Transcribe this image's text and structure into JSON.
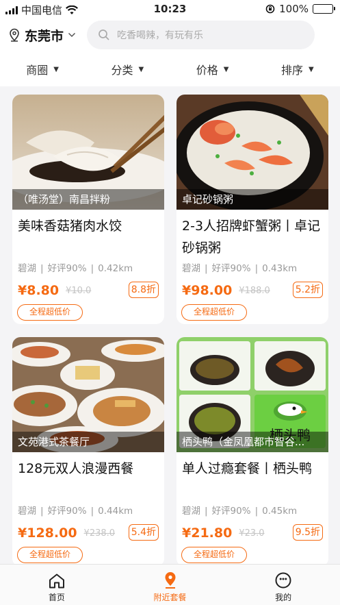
{
  "status_bar": {
    "carrier": "中国电信",
    "time": "10:23",
    "battery": "100%"
  },
  "header": {
    "city": "东莞市",
    "search_placeholder": "吃香喝辣，有玩有乐"
  },
  "filters": [
    {
      "label": "商圈"
    },
    {
      "label": "分类"
    },
    {
      "label": "价格"
    },
    {
      "label": "排序"
    }
  ],
  "cards": [
    {
      "shop": "（唯汤堂）南昌拌粉",
      "title": "美味香菇猪肉水饺",
      "area": "碧湖",
      "rating": "好评90%",
      "distance": "0.42km",
      "price": "¥8.80",
      "old_price": "¥10.0",
      "discount": "8.8折",
      "tag": "全程超低价"
    },
    {
      "shop": "卓记砂锅粥",
      "title": "2-3人招牌虾蟹粥丨卓记砂锅粥",
      "area": "碧湖",
      "rating": "好评90%",
      "distance": "0.43km",
      "price": "¥98.00",
      "old_price": "¥188.0",
      "discount": "5.2折",
      "tag": "全程超低价"
    },
    {
      "shop": "文苑港式茶餐厅",
      "title": "128元双人浪漫西餐",
      "area": "碧湖",
      "rating": "好评90%",
      "distance": "0.44km",
      "price": "¥128.00",
      "old_price": "¥238.0",
      "discount": "5.4折",
      "tag": "全程超低价"
    },
    {
      "shop": "栖头鸭（金凤凰都市智谷...",
      "title": "单人过瘾套餐丨栖头鸭",
      "area": "碧湖",
      "rating": "好评90%",
      "distance": "0.45km",
      "price": "¥21.80",
      "old_price": "¥23.0",
      "discount": "9.5折",
      "tag": "全程超低价",
      "logo_text": "栖头鸭"
    }
  ],
  "tabbar": [
    {
      "label": "首页",
      "icon": "home-icon"
    },
    {
      "label": "附近套餐",
      "icon": "location-pin-icon",
      "active": true
    },
    {
      "label": "我的",
      "icon": "profile-icon"
    }
  ],
  "colors": {
    "accent": "#f56a12",
    "background": "#f4f4f6"
  }
}
